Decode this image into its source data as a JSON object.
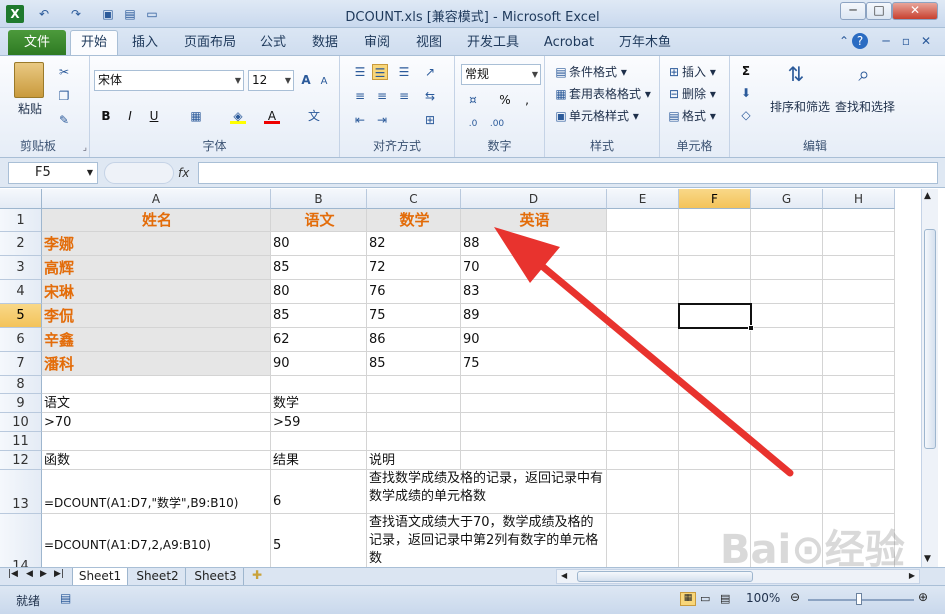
{
  "window": {
    "title": "DCOUNT.xls  [兼容模式] - Microsoft Excel",
    "minimize": "─",
    "maximize": "□",
    "close": "✕"
  },
  "tabs": {
    "file": "文件",
    "items": [
      "开始",
      "插入",
      "页面布局",
      "公式",
      "数据",
      "审阅",
      "视图",
      "开发工具",
      "Acrobat",
      "万年木鱼"
    ]
  },
  "ribbon": {
    "clipboard": {
      "label": "剪贴板",
      "paste": "粘贴"
    },
    "font": {
      "label": "字体",
      "name": "宋体",
      "size": "12",
      "bold": "B",
      "italic": "I",
      "underline": "U"
    },
    "alignment": {
      "label": "对齐方式"
    },
    "number": {
      "label": "数字",
      "format": "常规",
      "percent": "%",
      "comma": ","
    },
    "styles": {
      "label": "样式",
      "conditional": "条件格式",
      "table": "套用表格格式",
      "cell": "单元格样式"
    },
    "cells": {
      "label": "单元格",
      "insert": "插入",
      "delete": "删除",
      "format": "格式"
    },
    "editing": {
      "label": "编辑",
      "sort": "排序和筛选",
      "find": "查找和选择",
      "sigma": "Σ"
    }
  },
  "formula_bar": {
    "name_box": "F5",
    "fx": "fx",
    "value": ""
  },
  "columns": [
    "A",
    "B",
    "C",
    "D",
    "E",
    "F",
    "G",
    "H"
  ],
  "rows": [
    "1",
    "2",
    "3",
    "4",
    "5",
    "6",
    "7",
    "8",
    "9",
    "10",
    "11",
    "12",
    "13",
    "14"
  ],
  "cells": {
    "A1": "姓名",
    "B1": "语文",
    "C1": "数学",
    "D1": "英语",
    "A2": "李娜",
    "B2": "80",
    "C2": "82",
    "D2": "88",
    "A3": "高辉",
    "B3": "85",
    "C3": "72",
    "D3": "70",
    "A4": "宋琳",
    "B4": "80",
    "C4": "76",
    "D4": "83",
    "A5": "李侃",
    "B5": "85",
    "C5": "75",
    "D5": "89",
    "A6": "辛鑫",
    "B6": "62",
    "C6": "86",
    "D6": "90",
    "A7": "潘科",
    "B7": "90",
    "C7": "85",
    "D7": "75",
    "A9": "语文",
    "B9": "数学",
    "A10": ">70",
    "B10": ">59",
    "A12": "函数",
    "B12": "结果",
    "C12": "说明",
    "A13": "=DCOUNT(A1:D7,\"数学\",B9:B10)",
    "B13": "6",
    "C13": "查找数学成绩及格的记录，返回记录中有数学成绩的单元格数",
    "A14": "=DCOUNT(A1:D7,2,A9:B10)",
    "B14": "5",
    "C14": "查找语文成绩大于70，数学成绩及格的记录，返回记录中第2列有数字的单元格数"
  },
  "sheets": [
    "Sheet1",
    "Sheet2",
    "Sheet3"
  ],
  "status": {
    "mode": "就绪",
    "zoom": "100%"
  },
  "colors": {
    "accent": "#e36c09",
    "arrow": "#e8332e",
    "header_fill": "#e6e6e6"
  }
}
